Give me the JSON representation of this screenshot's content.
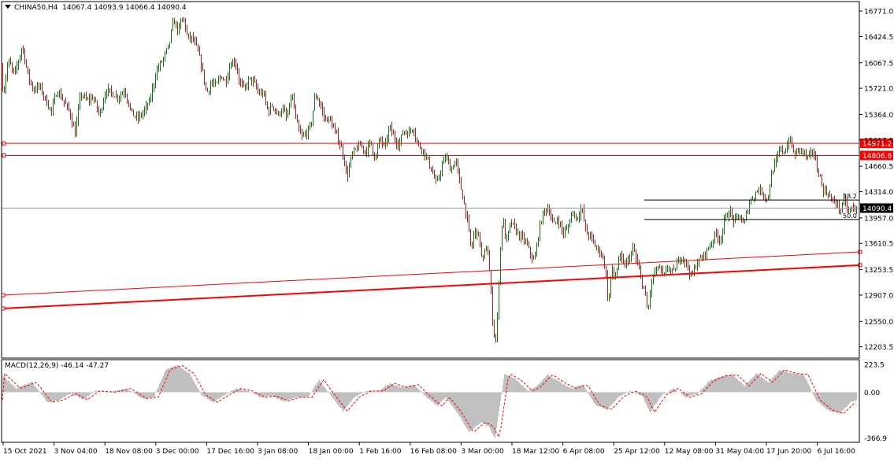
{
  "header": {
    "symbol": "CHINA50,H4",
    "ohlc": "14067.4 14093.9 14066.4 14090.4"
  },
  "macd": {
    "label": "MACD(12,26,9) -46.14 -47.27",
    "axis_labels": [
      "223.5",
      "0.00",
      "-366.9"
    ],
    "colors": {
      "histogram": "#c0c0c0",
      "signal": "#ff0000"
    }
  },
  "colors": {
    "bull": "#008000",
    "bear": "#ff0000",
    "wick": "#404040",
    "horizontal_line": "#ff0000",
    "trend_line": "#ff0000",
    "fib": "#000000",
    "bid_line": "#8a9cad"
  },
  "chart_data": {
    "type": "line",
    "title": "CHINA50,H4",
    "series_style": "candlestick",
    "ylim": [
      12050,
      16900
    ],
    "y_ticks": [
      16771.0,
      16424.5,
      16067.5,
      15721.0,
      15364.0,
      15017.5,
      14660.5,
      14314.0,
      13957.0,
      13610.5,
      13253.5,
      12907.0,
      12550.0,
      12203.5
    ],
    "x_ticks": [
      "15 Oct 2021",
      "3 Nov 04:00",
      "18 Nov 08:00",
      "3 Dec 00:00",
      "17 Dec 16:00",
      "3 Jan 08:00",
      "18 Jan 00:00",
      "1 Feb 16:00",
      "16 Feb 08:00",
      "3 Mar 00:00",
      "18 Mar 12:00",
      "6 Apr 08:00",
      "25 Apr 12:00",
      "12 May 08:00",
      "31 May 04:00",
      "17 Jun 20:00",
      "6 Jul 16:00"
    ],
    "price_path": [
      [
        0,
        16000
      ],
      [
        4,
        15650
      ],
      [
        10,
        16100
      ],
      [
        18,
        15900
      ],
      [
        28,
        16300
      ],
      [
        35,
        15900
      ],
      [
        42,
        15700
      ],
      [
        50,
        15750
      ],
      [
        58,
        15550
      ],
      [
        65,
        15400
      ],
      [
        72,
        15700
      ],
      [
        80,
        15550
      ],
      [
        88,
        15400
      ],
      [
        95,
        15100
      ],
      [
        102,
        15650
      ],
      [
        110,
        15550
      ],
      [
        118,
        15600
      ],
      [
        126,
        15350
      ],
      [
        134,
        15700
      ],
      [
        142,
        15650
      ],
      [
        150,
        15600
      ],
      [
        158,
        15700
      ],
      [
        166,
        15400
      ],
      [
        174,
        15300
      ],
      [
        182,
        15400
      ],
      [
        190,
        15550
      ],
      [
        198,
        15950
      ],
      [
        206,
        16100
      ],
      [
        214,
        16300
      ],
      [
        220,
        16650
      ],
      [
        226,
        16500
      ],
      [
        232,
        16700
      ],
      [
        238,
        16400
      ],
      [
        244,
        16400
      ],
      [
        250,
        16250
      ],
      [
        256,
        16000
      ],
      [
        262,
        15650
      ],
      [
        268,
        15800
      ],
      [
        274,
        15750
      ],
      [
        280,
        15900
      ],
      [
        286,
        15800
      ],
      [
        292,
        16050
      ],
      [
        298,
        16100
      ],
      [
        304,
        15800
      ],
      [
        310,
        15700
      ],
      [
        316,
        15850
      ],
      [
        322,
        15800
      ],
      [
        328,
        15650
      ],
      [
        334,
        15650
      ],
      [
        340,
        15400
      ],
      [
        346,
        15500
      ],
      [
        352,
        15350
      ],
      [
        358,
        15450
      ],
      [
        364,
        15300
      ],
      [
        370,
        15650
      ],
      [
        376,
        15250
      ],
      [
        382,
        15050
      ],
      [
        388,
        15100
      ],
      [
        394,
        15200
      ],
      [
        400,
        15650
      ],
      [
        406,
        15500
      ],
      [
        412,
        15300
      ],
      [
        418,
        15300
      ],
      [
        424,
        15150
      ],
      [
        430,
        15000
      ],
      [
        436,
        14800
      ],
      [
        440,
        14500
      ],
      [
        446,
        14800
      ],
      [
        452,
        14900
      ],
      [
        458,
        14950
      ],
      [
        464,
        14850
      ],
      [
        470,
        15000
      ],
      [
        476,
        14750
      ],
      [
        482,
        15050
      ],
      [
        488,
        14900
      ],
      [
        494,
        15200
      ],
      [
        500,
        15050
      ],
      [
        506,
        14950
      ],
      [
        512,
        15150
      ],
      [
        518,
        15100
      ],
      [
        524,
        15200
      ],
      [
        530,
        14950
      ],
      [
        536,
        14900
      ],
      [
        542,
        14750
      ],
      [
        548,
        14600
      ],
      [
        554,
        14400
      ],
      [
        560,
        14650
      ],
      [
        566,
        14800
      ],
      [
        572,
        14600
      ],
      [
        578,
        14750
      ],
      [
        584,
        14400
      ],
      [
        590,
        14100
      ],
      [
        594,
        13850
      ],
      [
        598,
        13500
      ],
      [
        602,
        13800
      ],
      [
        608,
        13700
      ],
      [
        612,
        13350
      ],
      [
        618,
        13600
      ],
      [
        622,
        13100
      ],
      [
        626,
        12400
      ],
      [
        630,
        12300
      ],
      [
        634,
        13400
      ],
      [
        638,
        14000
      ],
      [
        642,
        13600
      ],
      [
        648,
        13900
      ],
      [
        654,
        13800
      ],
      [
        660,
        13700
      ],
      [
        666,
        13650
      ],
      [
        672,
        13500
      ],
      [
        678,
        13350
      ],
      [
        684,
        13800
      ],
      [
        690,
        14050
      ],
      [
        696,
        14100
      ],
      [
        702,
        13850
      ],
      [
        708,
        13950
      ],
      [
        714,
        13750
      ],
      [
        720,
        13800
      ],
      [
        726,
        14050
      ],
      [
        732,
        13950
      ],
      [
        738,
        14100
      ],
      [
        744,
        13750
      ],
      [
        750,
        13700
      ],
      [
        756,
        13550
      ],
      [
        762,
        13500
      ],
      [
        768,
        13300
      ],
      [
        772,
        12750
      ],
      [
        776,
        13300
      ],
      [
        780,
        13100
      ],
      [
        786,
        13450
      ],
      [
        792,
        13300
      ],
      [
        798,
        13400
      ],
      [
        804,
        13550
      ],
      [
        808,
        13350
      ],
      [
        812,
        13200
      ],
      [
        818,
        12950
      ],
      [
        822,
        12650
      ],
      [
        826,
        13050
      ],
      [
        830,
        13200
      ],
      [
        836,
        13300
      ],
      [
        842,
        13150
      ],
      [
        848,
        13300
      ],
      [
        854,
        13200
      ],
      [
        860,
        13350
      ],
      [
        866,
        13450
      ],
      [
        872,
        13300
      ],
      [
        878,
        13150
      ],
      [
        884,
        13350
      ],
      [
        890,
        13400
      ],
      [
        896,
        13500
      ],
      [
        902,
        13600
      ],
      [
        908,
        13750
      ],
      [
        914,
        13650
      ],
      [
        920,
        13950
      ],
      [
        926,
        14050
      ],
      [
        932,
        13900
      ],
      [
        938,
        14000
      ],
      [
        944,
        13850
      ],
      [
        950,
        14150
      ],
      [
        956,
        14250
      ],
      [
        962,
        14350
      ],
      [
        968,
        14300
      ],
      [
        974,
        14200
      ],
      [
        980,
        14600
      ],
      [
        986,
        14750
      ],
      [
        990,
        14900
      ],
      [
        996,
        14850
      ],
      [
        1002,
        15050
      ],
      [
        1008,
        14800
      ],
      [
        1014,
        14900
      ],
      [
        1020,
        14850
      ],
      [
        1026,
        14750
      ],
      [
        1032,
        14900
      ],
      [
        1036,
        14650
      ],
      [
        1040,
        14550
      ],
      [
        1044,
        14350
      ],
      [
        1048,
        14300
      ],
      [
        1052,
        14300
      ],
      [
        1056,
        14150
      ],
      [
        1060,
        14200
      ],
      [
        1064,
        14100
      ],
      [
        1068,
        14050
      ],
      [
        1072,
        14250
      ],
      [
        1076,
        14000
      ],
      [
        1080,
        14100
      ],
      [
        1084,
        14080
      ],
      [
        1088,
        14090
      ]
    ],
    "horizontal_lines": [
      {
        "price": 14971.2,
        "label": "14971.2"
      },
      {
        "price": 14806.6,
        "label": "14806.6"
      }
    ],
    "current_price": {
      "price": 14090.4,
      "label": "14090.4"
    },
    "fibonacci": [
      {
        "price": 14200,
        "label": "38.2"
      },
      {
        "price": 13935,
        "label": "50.0"
      }
    ],
    "trend_lines": [
      {
        "from": [
          0,
          12905
        ],
        "to": [
          1090,
          13495
        ]
      },
      {
        "from": [
          0,
          12725
        ],
        "to": [
          1090,
          13315
        ]
      }
    ],
    "macd_ylim": [
      -400,
      260
    ],
    "macd_path": [
      [
        0,
        150
      ],
      [
        20,
        30
      ],
      [
        40,
        80
      ],
      [
        60,
        -80
      ],
      [
        75,
        -60
      ],
      [
        90,
        -10
      ],
      [
        105,
        -60
      ],
      [
        120,
        10
      ],
      [
        140,
        0
      ],
      [
        160,
        30
      ],
      [
        180,
        -50
      ],
      [
        195,
        -40
      ],
      [
        210,
        180
      ],
      [
        225,
        215
      ],
      [
        240,
        150
      ],
      [
        255,
        -20
      ],
      [
        270,
        -80
      ],
      [
        285,
        -20
      ],
      [
        300,
        30
      ],
      [
        315,
        10
      ],
      [
        330,
        -40
      ],
      [
        345,
        -30
      ],
      [
        360,
        -70
      ],
      [
        375,
        -40
      ],
      [
        390,
        -40
      ],
      [
        405,
        100
      ],
      [
        420,
        -30
      ],
      [
        435,
        -150
      ],
      [
        450,
        -40
      ],
      [
        465,
        10
      ],
      [
        480,
        10
      ],
      [
        495,
        70
      ],
      [
        510,
        40
      ],
      [
        525,
        60
      ],
      [
        540,
        -30
      ],
      [
        555,
        -110
      ],
      [
        565,
        -40
      ],
      [
        580,
        -160
      ],
      [
        595,
        -320
      ],
      [
        610,
        -240
      ],
      [
        620,
        -270
      ],
      [
        628,
        -370
      ],
      [
        640,
        150
      ],
      [
        655,
        100
      ],
      [
        670,
        10
      ],
      [
        680,
        40
      ],
      [
        695,
        140
      ],
      [
        710,
        80
      ],
      [
        725,
        30
      ],
      [
        740,
        60
      ],
      [
        755,
        -100
      ],
      [
        770,
        -140
      ],
      [
        785,
        -40
      ],
      [
        800,
        10
      ],
      [
        815,
        -30
      ],
      [
        825,
        -160
      ],
      [
        840,
        -20
      ],
      [
        855,
        30
      ],
      [
        870,
        -40
      ],
      [
        885,
        -10
      ],
      [
        900,
        90
      ],
      [
        915,
        130
      ],
      [
        930,
        140
      ],
      [
        945,
        50
      ],
      [
        960,
        150
      ],
      [
        975,
        80
      ],
      [
        990,
        180
      ],
      [
        1005,
        150
      ],
      [
        1020,
        140
      ],
      [
        1035,
        -60
      ],
      [
        1050,
        -140
      ],
      [
        1065,
        -170
      ],
      [
        1080,
        -80
      ],
      [
        1088,
        -60
      ]
    ]
  }
}
